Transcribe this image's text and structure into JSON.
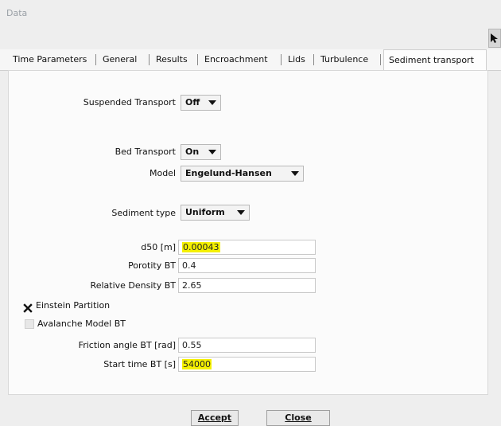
{
  "window": {
    "title": "Data"
  },
  "tabs": [
    {
      "label": "Time Parameters",
      "active": false
    },
    {
      "label": "General",
      "active": false
    },
    {
      "label": "Results",
      "active": false
    },
    {
      "label": "Encroachment",
      "active": false
    },
    {
      "label": "Lids",
      "active": false
    },
    {
      "label": "Turbulence",
      "active": false
    },
    {
      "label": "Sediment transport",
      "active": true
    }
  ],
  "sediment": {
    "suspended_transport": {
      "label": "Suspended Transport",
      "value": "Off"
    },
    "bed_transport": {
      "label": "Bed Transport",
      "value": "On"
    },
    "model": {
      "label": "Model",
      "value": "Engelund-Hansen"
    },
    "sediment_type": {
      "label": "Sediment type",
      "value": "Uniform"
    },
    "d50": {
      "label": "d50 [m]",
      "value": "0.00043",
      "highlighted": true
    },
    "porosity": {
      "label": "Porotity BT",
      "value": "0.4"
    },
    "relative_density": {
      "label": "Relative Density BT",
      "value": "2.65"
    },
    "einstein_partition": {
      "label": "Einstein Partition",
      "checked": true
    },
    "avalanche_model": {
      "label": "Avalanche Model BT",
      "checked": false
    },
    "friction_angle": {
      "label": "Friction angle BT [rad]",
      "value": "0.55"
    },
    "start_time": {
      "label": "Start time BT [s]",
      "value": "54000",
      "highlighted": true
    }
  },
  "buttons": {
    "accept": "Accept",
    "close": "Close"
  },
  "colors": {
    "highlight": "#f4f000"
  }
}
